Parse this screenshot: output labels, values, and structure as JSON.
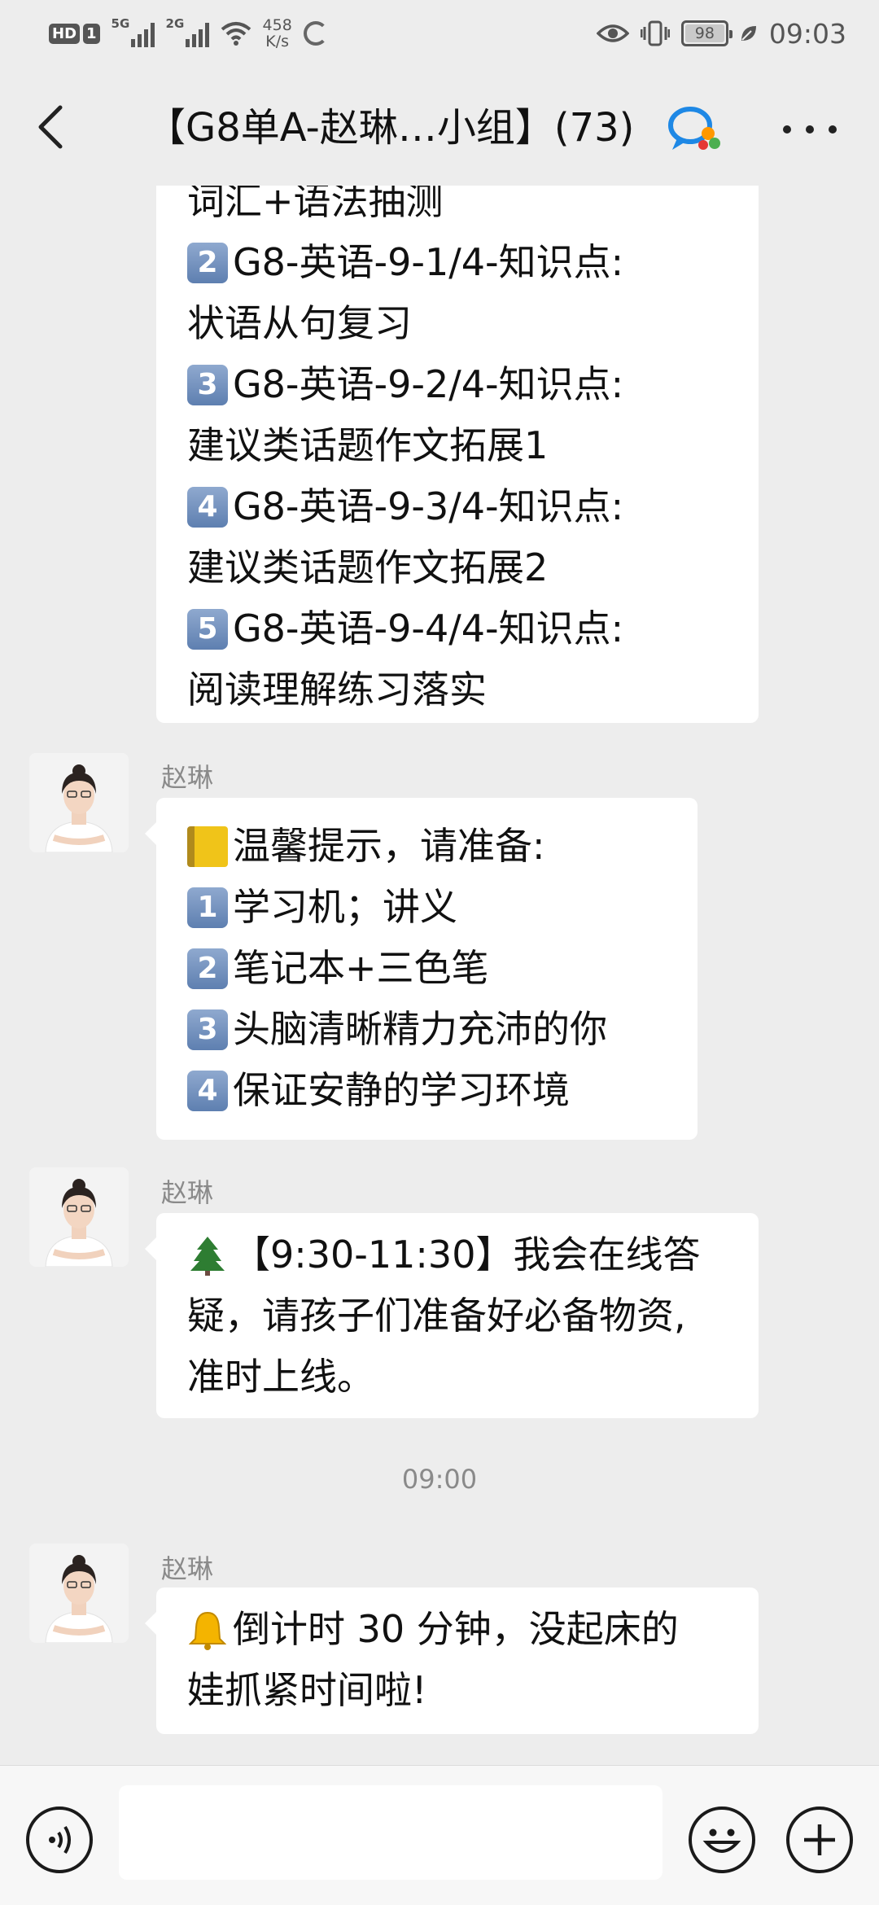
{
  "status_bar": {
    "hd_label": "HD",
    "sim1": "1",
    "net1": "5G",
    "net2": "2G",
    "speed_value": "458",
    "speed_unit": "K/s",
    "battery": "98",
    "time": "09:03",
    "icons": [
      "hd-icon",
      "signal-5g-icon",
      "signal-2g-icon",
      "wifi-icon",
      "loading-ring-icon",
      "eye-comfort-icon",
      "vibrate-icon",
      "battery-icon",
      "leaf-icon"
    ]
  },
  "nav": {
    "title": "【G8单A-赵琳…小组】(73)",
    "icons": [
      "back-chevron-icon",
      "group-chat-icon",
      "more-dots-icon"
    ]
  },
  "messages": [
    {
      "id": "msg1",
      "sender": "",
      "lines": [
        {
          "emoji": "",
          "text": "词汇+语法抽测"
        },
        {
          "emoji": "2",
          "text": "G8-英语-9-1/4-知识点:"
        },
        {
          "emoji": "",
          "text": "状语从句复习"
        },
        {
          "emoji": "3",
          "text": "G8-英语-9-2/4-知识点:"
        },
        {
          "emoji": "",
          "text": "建议类话题作文拓展1"
        },
        {
          "emoji": "4",
          "text": "G8-英语-9-3/4-知识点:"
        },
        {
          "emoji": "",
          "text": "建议类话题作文拓展2"
        },
        {
          "emoji": "5",
          "text": "G8-英语-9-4/4-知识点:"
        },
        {
          "emoji": "",
          "text": "阅读理解练习落实"
        }
      ]
    },
    {
      "id": "msg2",
      "sender": "赵琳",
      "lines": [
        {
          "emoji": "notebook",
          "text": "温馨提示，请准备:"
        },
        {
          "emoji": "1",
          "text": "学习机；讲义"
        },
        {
          "emoji": "2",
          "text": "笔记本+三色笔"
        },
        {
          "emoji": "3",
          "text": "头脑清晰精力充沛的你"
        },
        {
          "emoji": "4",
          "text": "保证安静的学习环境"
        }
      ]
    },
    {
      "id": "msg3",
      "sender": "赵琳",
      "lines": [
        {
          "emoji": "tree",
          "text": "【9:30-11:30】我会在线答"
        },
        {
          "emoji": "",
          "text": "疑，请孩子们准备好必备物资,"
        },
        {
          "emoji": "",
          "text": "准时上线。"
        }
      ]
    },
    {
      "id": "msg4",
      "sender": "赵琳",
      "lines": [
        {
          "emoji": "bell",
          "text": "倒计时 30 分钟，没起床的"
        },
        {
          "emoji": "",
          "text": "娃抓紧时间啦!"
        }
      ]
    }
  ],
  "time_separator": "09:00",
  "input_bar": {
    "placeholder": "",
    "icons": [
      "voice-icon",
      "emoji-icon",
      "plus-icon"
    ]
  }
}
